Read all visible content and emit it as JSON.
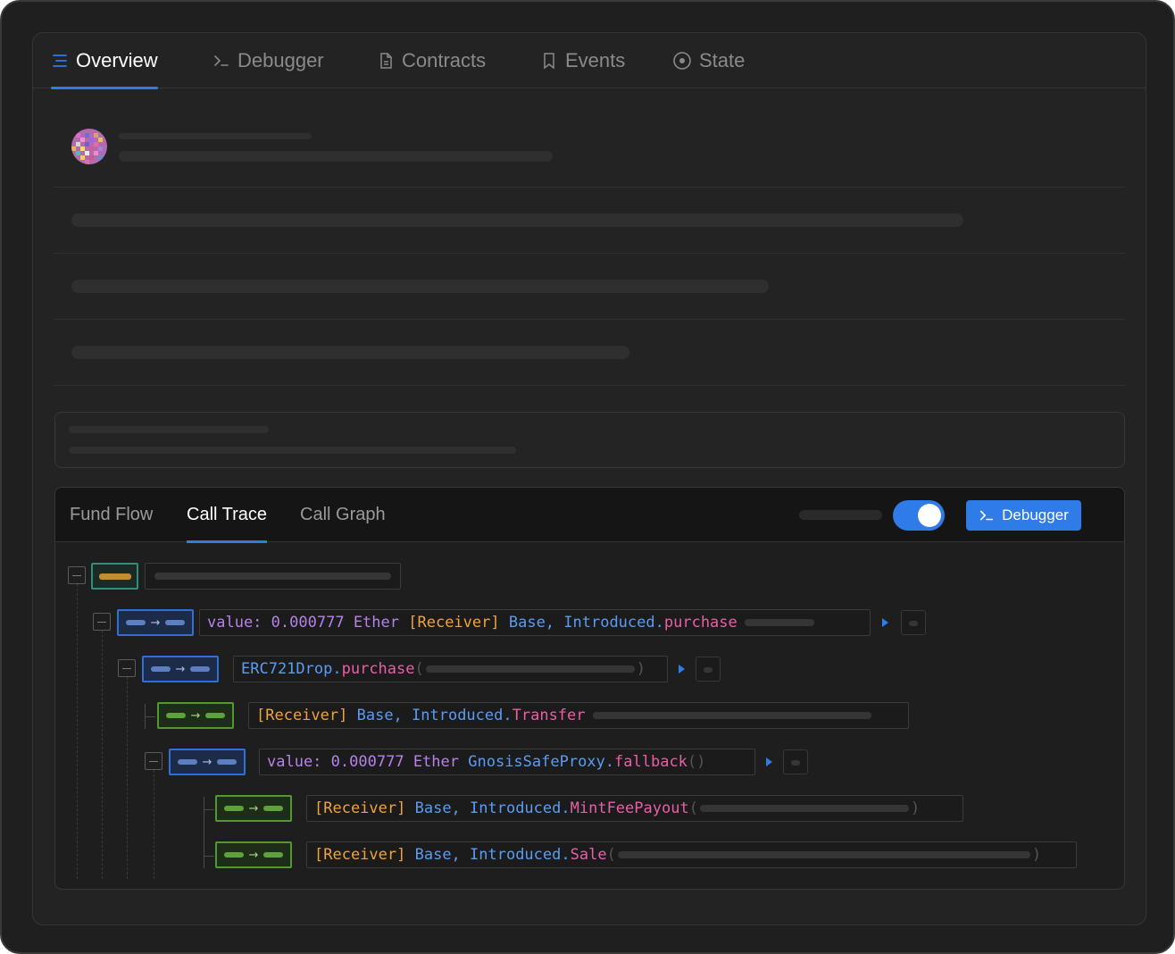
{
  "tabs": [
    {
      "label": "Overview",
      "icon": "list-icon",
      "active": true
    },
    {
      "label": "Debugger",
      "icon": "terminal-icon",
      "active": false
    },
    {
      "label": "Contracts",
      "icon": "file-icon",
      "active": false
    },
    {
      "label": "Events",
      "icon": "bookmark-icon",
      "active": false
    },
    {
      "label": "State",
      "icon": "target-icon",
      "active": false
    }
  ],
  "trace_tabs": [
    {
      "label": "Fund Flow",
      "active": false
    },
    {
      "label": "Call Trace",
      "active": true
    },
    {
      "label": "Call Graph",
      "active": false
    }
  ],
  "debugger_button": "Debugger",
  "toggle_on": true,
  "colors": {
    "accent": "#2f7be8",
    "value": "#b583e8",
    "receiver": "#f0a33a",
    "contract": "#5b9cf2",
    "method": "#e85fa6"
  },
  "rows": [
    {
      "value_label": "value:",
      "value_amount": "0.000777",
      "value_unit": "Ether",
      "receiver": "[Receiver]",
      "contract": "Base, Introduced",
      "dot": ".",
      "method": "purchase"
    },
    {
      "contract": "ERC721Drop",
      "dot": ".",
      "method": "purchase",
      "open": "(",
      "close": ")"
    },
    {
      "receiver": "[Receiver]",
      "contract": "Base, Introduced",
      "dot": ".",
      "method": "Transfer"
    },
    {
      "value_label": "value:",
      "value_amount": "0.000777",
      "value_unit": "Ether",
      "contract": "GnosisSafeProxy",
      "dot": ".",
      "method": "fallback",
      "open": "(",
      "close": ")"
    },
    {
      "receiver": "[Receiver]",
      "contract": "Base, Introduced",
      "dot": ".",
      "method": "MintFeePayout",
      "open": "(",
      "close": ")"
    },
    {
      "receiver": "[Receiver]",
      "contract": "Base, Introduced",
      "dot": ".",
      "method": "Sale",
      "open": "(",
      "close": ")"
    }
  ]
}
